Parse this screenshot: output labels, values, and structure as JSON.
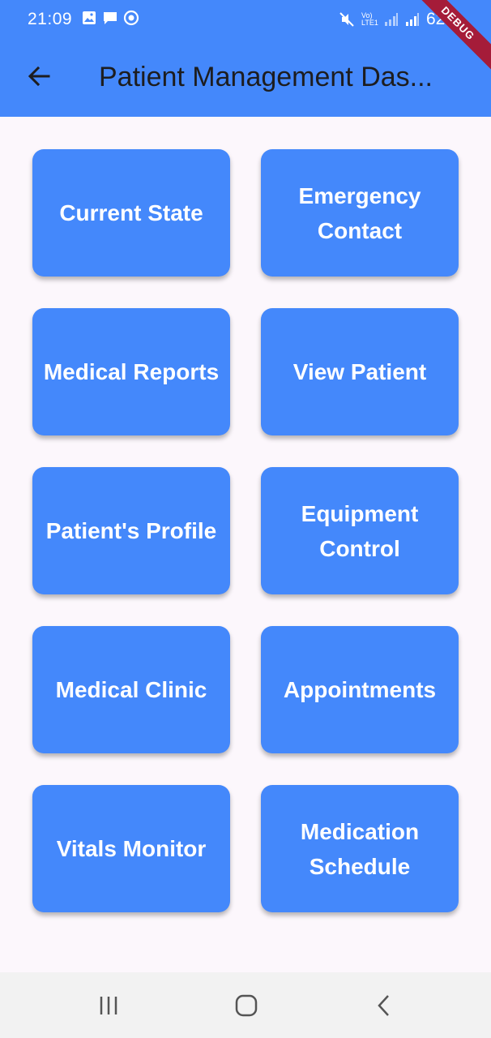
{
  "status_bar": {
    "time": "21:09",
    "battery": "62%",
    "network": "Vo) LTE1"
  },
  "debug_banner": "DEBUG",
  "appbar": {
    "title": "Patient Management Das...",
    "back_icon": "arrow-left-icon",
    "color": "#4488fb"
  },
  "tiles": [
    {
      "label": "Current State"
    },
    {
      "label": "Emergency Contact"
    },
    {
      "label": "Medical Reports"
    },
    {
      "label": "View Patient"
    },
    {
      "label": "Patient's Profile"
    },
    {
      "label": "Equipment Control"
    },
    {
      "label": "Medical Clinic"
    },
    {
      "label": "Appointments"
    },
    {
      "label": "Vitals Monitor"
    },
    {
      "label": "Medication Schedule"
    }
  ],
  "navbar": {
    "recents_icon": "recents-icon",
    "home_icon": "home-icon",
    "back_icon": "back-chevron-icon"
  }
}
